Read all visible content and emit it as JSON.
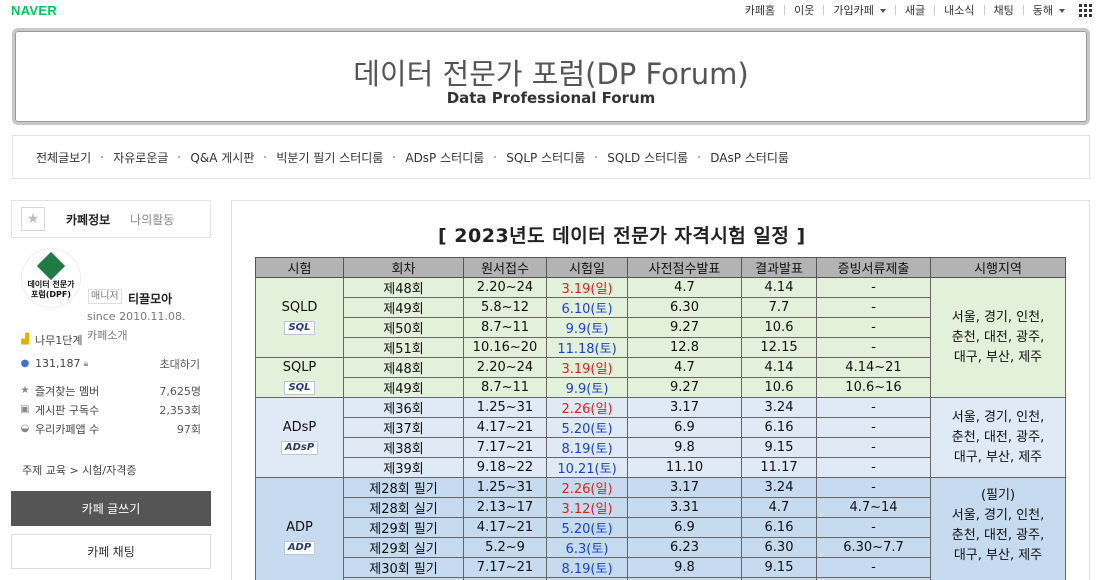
{
  "topbar": {
    "logo": "NAVER",
    "items": [
      "카페홈",
      "이웃",
      "가입카페",
      "새글",
      "내소식",
      "채팅",
      "동해"
    ]
  },
  "banner": {
    "title": "데이터 전문가 포럼(DP Forum)",
    "subtitle": "Data Professional Forum"
  },
  "menu": [
    "전체글보기",
    "자유로운글",
    "Q&A 게시판",
    "빅분기 필기 스터디룸",
    "ADsP 스터디룸",
    "SQLP 스터디룸",
    "SQLD 스터디룸",
    "DAsP 스터디룸"
  ],
  "sidebar": {
    "tab_info": "카페정보",
    "tab_activity": "나의활동",
    "logo_text_1": "데이터 전문가",
    "logo_text_2": "포럼(DPF)",
    "manager_badge": "매니저",
    "manager_name": "티끌모아",
    "since": "since 2010.11.08.",
    "intro": "카페소개",
    "level": "나무1단계",
    "members": "131,187",
    "invite": "초대하기",
    "stats": [
      {
        "label": "즐겨찾는 멤버",
        "value": "7,625명"
      },
      {
        "label": "게시판 구독수",
        "value": "2,353회"
      },
      {
        "label": "우리카페앱 수",
        "value": "97회"
      }
    ],
    "theme": "주제 교육 > 시험/자격증",
    "write_button": "카페 글쓰기",
    "chat_button": "카페 채팅"
  },
  "main": {
    "title": "[ 2023년도 데이터 전문가 자격시험 일정 ]",
    "headers": [
      "시험",
      "회차",
      "원서접수",
      "시험일",
      "사전점수발표",
      "결과발표",
      "증빙서류제출",
      "시행지역"
    ],
    "groups": [
      {
        "exam": "SQLD",
        "badge": "SQL",
        "rows": [
          [
            "제48회",
            "2.20~24",
            "3.19(일)",
            "4.7",
            "4.14",
            "-"
          ],
          [
            "제49회",
            "5.8~12",
            "6.10(토)",
            "6.30",
            "7.7",
            "-"
          ],
          [
            "제50회",
            "8.7~11",
            "9.9(토)",
            "9.27",
            "10.6",
            "-"
          ],
          [
            "제51회",
            "10.16~20",
            "11.18(토)",
            "12.8",
            "12.15",
            "-"
          ]
        ]
      },
      {
        "exam": "SQLP",
        "badge": "SQL",
        "rows": [
          [
            "제48회",
            "2.20~24",
            "3.19(일)",
            "4.7",
            "4.14",
            "4.14~21"
          ],
          [
            "제49회",
            "8.7~11",
            "9.9(토)",
            "9.27",
            "10.6",
            "10.6~16"
          ]
        ]
      },
      {
        "exam": "ADsP",
        "badge": "ADsP",
        "rows": [
          [
            "제36회",
            "1.25~31",
            "2.26(일)",
            "3.17",
            "3.24",
            "-"
          ],
          [
            "제37회",
            "4.17~21",
            "5.20(토)",
            "6.9",
            "6.16",
            "-"
          ],
          [
            "제38회",
            "7.17~21",
            "8.19(토)",
            "9.8",
            "9.15",
            "-"
          ],
          [
            "제39회",
            "9.18~22",
            "10.21(토)",
            "11.10",
            "11.17",
            "-"
          ]
        ]
      },
      {
        "exam": "ADP",
        "badge": "ADP",
        "rows": [
          [
            "제28회 필기",
            "1.25~31",
            "2.26(일)",
            "3.17",
            "3.24",
            "-"
          ],
          [
            "제28회 실기",
            "2.13~17",
            "3.12(일)",
            "3.31",
            "4.7",
            "4.7~14"
          ],
          [
            "제29회 필기",
            "4.17~21",
            "5.20(토)",
            "6.9",
            "6.16",
            "-"
          ],
          [
            "제29회 실기",
            "5.2~9",
            "6.3(토)",
            "6.23",
            "6.30",
            "6.30~7.7"
          ],
          [
            "제30회 필기",
            "7.17~21",
            "8.19(토)",
            "9.8",
            "9.15",
            "-"
          ]
        ]
      }
    ],
    "region_a": [
      "서울, 경기, 인천,",
      "춘천, 대전, 광주,",
      "대구, 부산, 제주"
    ],
    "region_b": [
      "(필기)",
      "서울, 경기, 인천,",
      "춘천, 대전, 광주,",
      "대구, 부산, 제주"
    ]
  }
}
